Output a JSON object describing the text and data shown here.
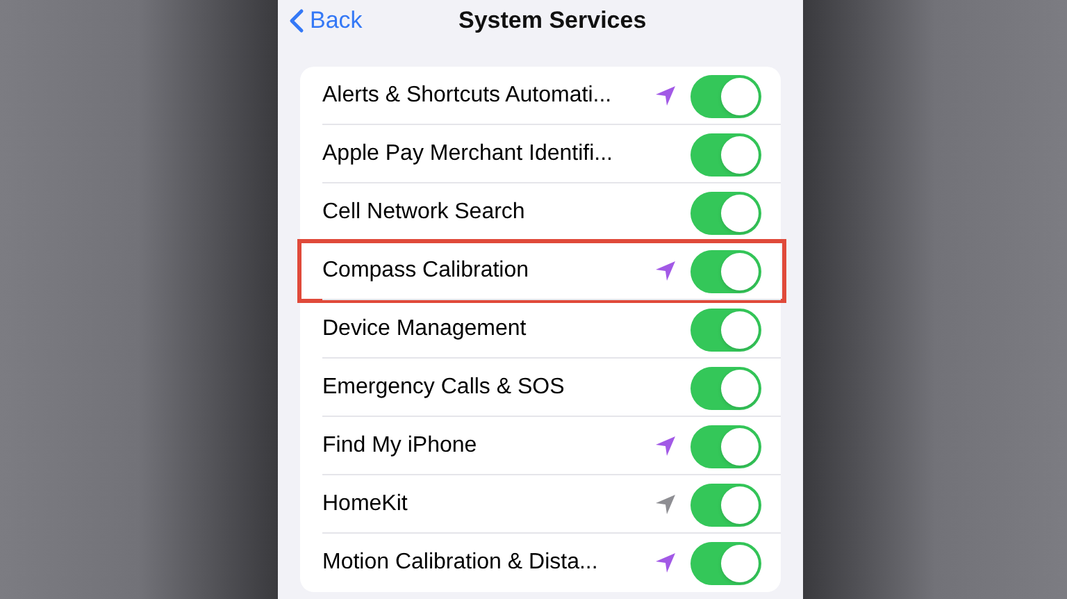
{
  "nav": {
    "back": "Back",
    "title": "System Services"
  },
  "rows": [
    {
      "label": "Alerts & Shortcuts Automati...",
      "on": true,
      "highlighted": false,
      "color": "#a259e6"
    },
    {
      "label": "Apple Pay Merchant Identifi...",
      "on": true,
      "highlighted": false
    },
    {
      "label": "Cell Network Search",
      "on": true,
      "highlighted": false
    },
    {
      "label": "Compass Calibration",
      "on": true,
      "highlighted": true,
      "color": "#a259e6"
    },
    {
      "label": "Device Management",
      "on": true,
      "highlighted": false
    },
    {
      "label": "Emergency Calls & SOS",
      "on": true,
      "highlighted": false
    },
    {
      "label": "Find My iPhone",
      "on": true,
      "highlighted": false,
      "color": "#a259e6"
    },
    {
      "label": "HomeKit",
      "on": true,
      "highlighted": false,
      "color": "#8e8e93"
    },
    {
      "label": "Motion Calibration & Dista...",
      "on": true,
      "highlighted": false,
      "color": "#a259e6"
    }
  ]
}
